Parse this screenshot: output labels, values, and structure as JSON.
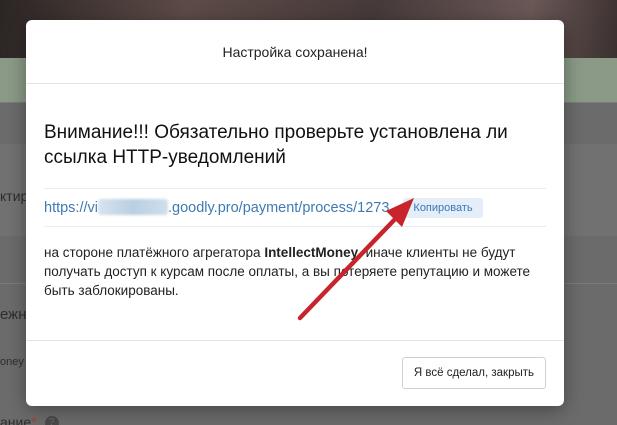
{
  "background": {
    "partial_label_1": "ктир",
    "partial_label_2": "ежн",
    "partial_label_3": "oney",
    "partial_label_4": "ание",
    "required_mark": "*",
    "help_glyph": "?"
  },
  "modal": {
    "title": "Настройка сохранена!",
    "heading": "Внимание!!! Обязательно проверьте установлена ли ссылка HTTP-уведомлений",
    "url_prefix": "https://vi",
    "url_suffix": ".goodly.pro/payment/process/1273",
    "copy_label": "Копировать",
    "note_before": "на стороне платёжного агрегатора ",
    "note_bold": "IntellectMoney",
    "note_after": ", иначе клиенты не будут получать доступ к курсам после оплаты, а вы потеряете репутацию и можете быть заблокированы.",
    "close_label": "Я всё сделал, закрыть"
  },
  "colors": {
    "link": "#3e7ab3",
    "copy_bg": "#e3eef8",
    "arrow": "#c8242b"
  },
  "icons": {
    "annotation": "red-arrow-icon"
  }
}
